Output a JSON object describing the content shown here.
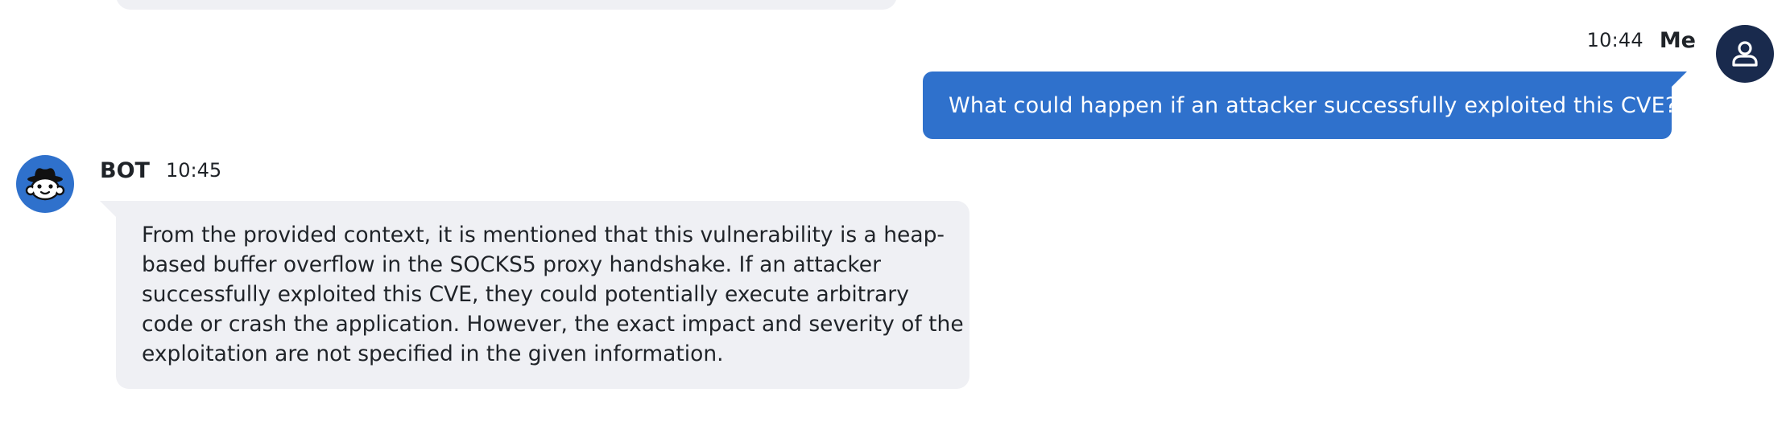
{
  "conversation": {
    "user_message": {
      "time": "10:44",
      "sender": "Me",
      "text": "What could happen if an attacker successfully exploited this CVE?"
    },
    "bot_message": {
      "sender": "BOT",
      "time": "10:45",
      "lines": [
        "From the provided context, it is mentioned that this vulnerability is a heap-",
        "based buffer overflow in the SOCKS5 proxy handshake. If an attacker",
        "successfully exploited this CVE, they could potentially execute arbitrary",
        "code or crash the application. However, the exact impact and severity of the",
        "exploitation are not specified in the given information."
      ]
    }
  },
  "icons": {
    "user_avatar": "user-icon",
    "bot_avatar": "spy-bot-icon"
  },
  "colors": {
    "user_bubble": "#2f71cc",
    "bot_bubble": "#eff0f4",
    "user_avatar_bg": "#192a4d",
    "bot_avatar_bg": "#2f71cc"
  }
}
